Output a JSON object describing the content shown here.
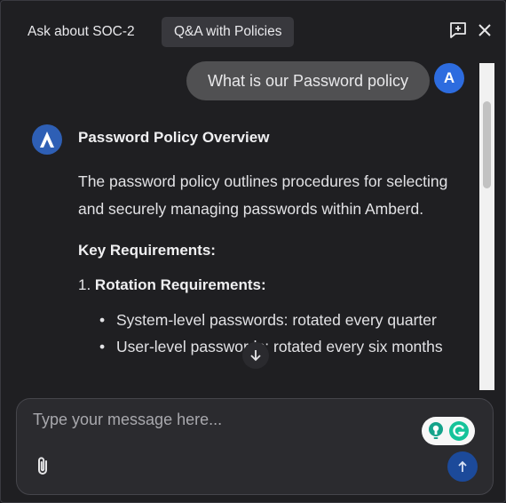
{
  "header": {
    "tabs": [
      {
        "label": "Ask about SOC-2"
      },
      {
        "label": "Q&A with Policies"
      }
    ]
  },
  "conversation": {
    "user_message": "What is our Password policy",
    "user_avatar_letter": "A",
    "assistant": {
      "title": "Password Policy Overview",
      "body": "The password policy outlines procedures for selecting and securely managing passwords within Amberd.",
      "subheading": "Key Requirements:",
      "list_number": "1.",
      "list_item_label": "Rotation Requirements:",
      "bullets": [
        "System-level passwords: rotated every quarter",
        "User-level passwords: rotated every six months"
      ]
    }
  },
  "composer": {
    "placeholder": "Type your message here..."
  },
  "colors": {
    "accent": "#2d6cdf",
    "send_button": "#1c4a9a",
    "background": "#1f1f22"
  },
  "icons": [
    "new-chat-icon",
    "close-icon",
    "jump-down-icon",
    "attach-icon",
    "grammarly-icon",
    "send-icon",
    "bot-logo-icon"
  ]
}
